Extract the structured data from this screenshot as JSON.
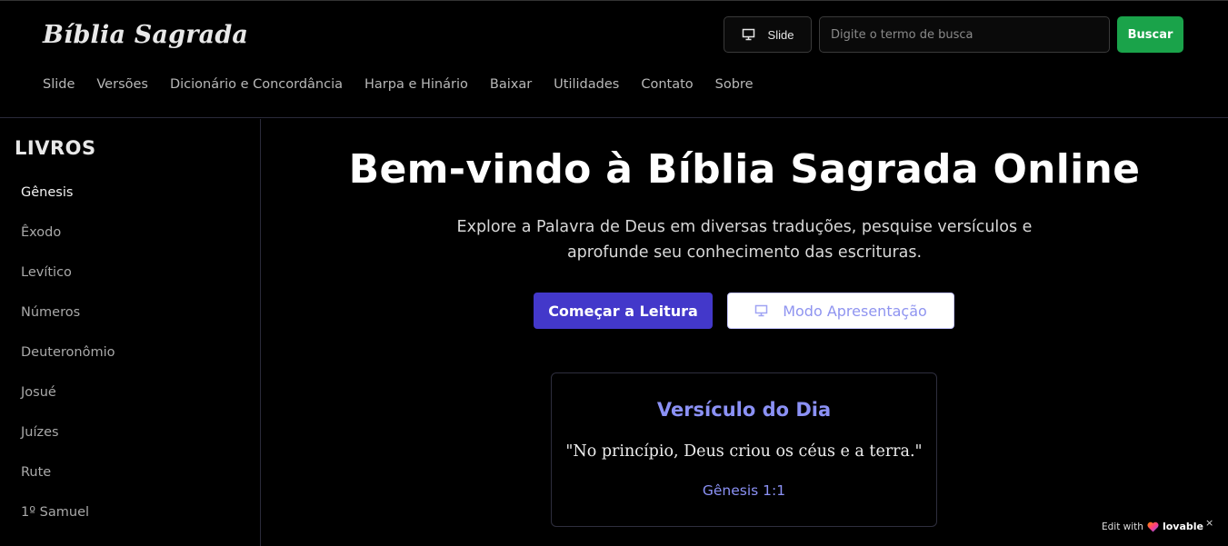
{
  "header": {
    "brand": "Bíblia Sagrada",
    "slide_label": "Slide",
    "search_placeholder": "Digite o termo de busca",
    "search_button": "Buscar"
  },
  "nav": {
    "items": [
      "Slide",
      "Versões",
      "Dicionário e Concordância",
      "Harpa e Hinário",
      "Baixar",
      "Utilidades",
      "Contato",
      "Sobre"
    ]
  },
  "sidebar": {
    "title": "LIVROS",
    "books": [
      "Gênesis",
      "Êxodo",
      "Levítico",
      "Números",
      "Deuteronômio",
      "Josué",
      "Juízes",
      "Rute",
      "1º Samuel"
    ],
    "active": "Gênesis"
  },
  "hero": {
    "title": "Bem-vindo à Bíblia Sagrada Online",
    "subtitle": "Explore a Palavra de Deus em diversas traduções, pesquise versículos e aprofunde seu conhecimento das escrituras.",
    "primary_button": "Começar a Leitura",
    "secondary_button": "Modo Apresentação"
  },
  "verse": {
    "title": "Versículo do Dia",
    "text": "\"No princípio, Deus criou os céus e a terra.\"",
    "reference": "Gênesis 1:1"
  },
  "badge": {
    "edit_with": "Edit with",
    "brand": "lovable",
    "close": "×"
  },
  "colors": {
    "background": "#000000",
    "accent": "#4338ca",
    "accent_text": "#8b91f5",
    "search_button": "#1aa34a"
  }
}
